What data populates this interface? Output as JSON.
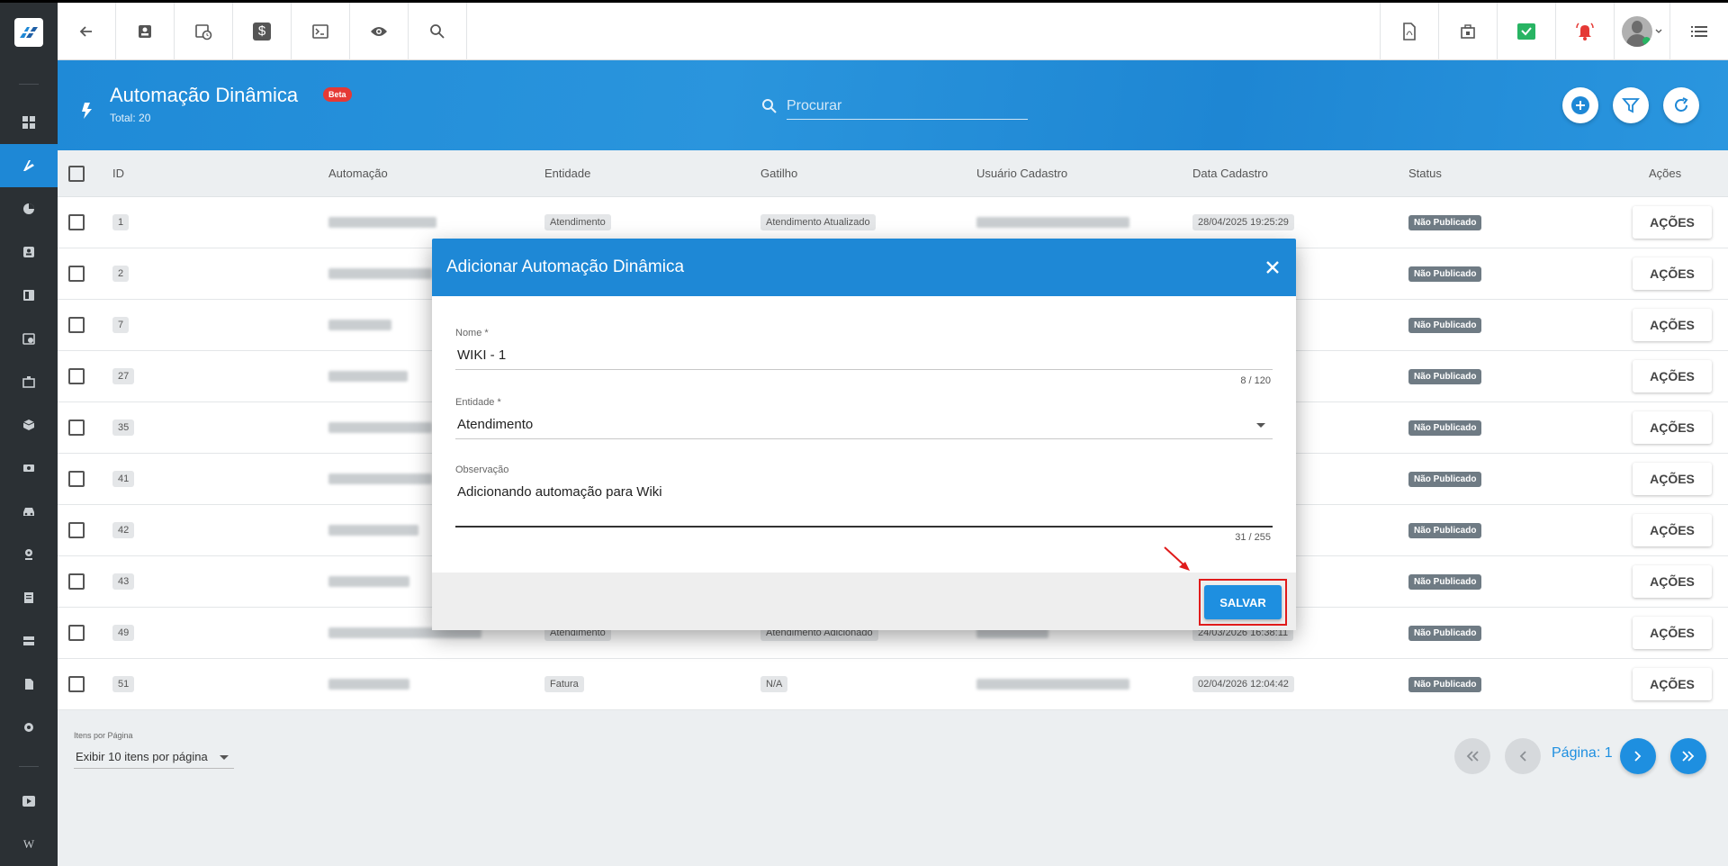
{
  "header": {
    "title": "Automação Dinâmica",
    "badge": "Beta",
    "total": "Total: 20"
  },
  "search": {
    "placeholder": "Procurar"
  },
  "table": {
    "columns": [
      "ID",
      "Automação",
      "Entidade",
      "Gatilho",
      "Usuário Cadastro",
      "Data Cadastro",
      "Status",
      "Ações"
    ],
    "rows": [
      {
        "id": "1",
        "entity": "Atendimento",
        "trigger": "Atendimento Atualizado",
        "date": "28/04/2025 19:25:29",
        "status": "Não Publicado",
        "action": "AÇÕES"
      },
      {
        "id": "2",
        "entity": "",
        "trigger": "",
        "date": "",
        "status": "Não Publicado",
        "action": "AÇÕES"
      },
      {
        "id": "7",
        "entity": "",
        "trigger": "",
        "date": "",
        "status": "Não Publicado",
        "action": "AÇÕES"
      },
      {
        "id": "27",
        "entity": "",
        "trigger": "",
        "date": "",
        "status": "Não Publicado",
        "action": "AÇÕES"
      },
      {
        "id": "35",
        "entity": "",
        "trigger": "",
        "date": "",
        "status": "Não Publicado",
        "action": "AÇÕES"
      },
      {
        "id": "41",
        "entity": "",
        "trigger": "",
        "date": "",
        "status": "Não Publicado",
        "action": "AÇÕES"
      },
      {
        "id": "42",
        "entity": "",
        "trigger": "",
        "date": "",
        "status": "Não Publicado",
        "action": "AÇÕES"
      },
      {
        "id": "43",
        "entity": "",
        "trigger": "",
        "date": "",
        "status": "Não Publicado",
        "action": "AÇÕES"
      },
      {
        "id": "49",
        "entity": "Atendimento",
        "trigger": "Atendimento Adicionado",
        "date": "24/03/2026 16:38:11",
        "status": "Não Publicado",
        "action": "AÇÕES"
      },
      {
        "id": "51",
        "entity": "Fatura",
        "trigger": "N/A",
        "date": "02/04/2026 12:04:42",
        "status": "Não Publicado",
        "action": "AÇÕES"
      }
    ]
  },
  "pagination": {
    "per_page_label": "Itens por Página",
    "per_page_value": "Exibir 10 itens por página",
    "page_label": "Página: 1"
  },
  "modal": {
    "title": "Adicionar Automação Dinâmica",
    "name_label": "Nome *",
    "name_value": "WIKI - 1",
    "name_count": "8 / 120",
    "entity_label": "Entidade *",
    "entity_value": "Atendimento",
    "obs_label": "Observação",
    "obs_value": "Adicionando automação para Wiki",
    "obs_count": "31 / 255",
    "save_label": "SALVAR"
  },
  "colors": {
    "primary": "#1e88d6",
    "highlight": "#e01b1b",
    "alert": "#e53935",
    "success": "#28b463"
  }
}
